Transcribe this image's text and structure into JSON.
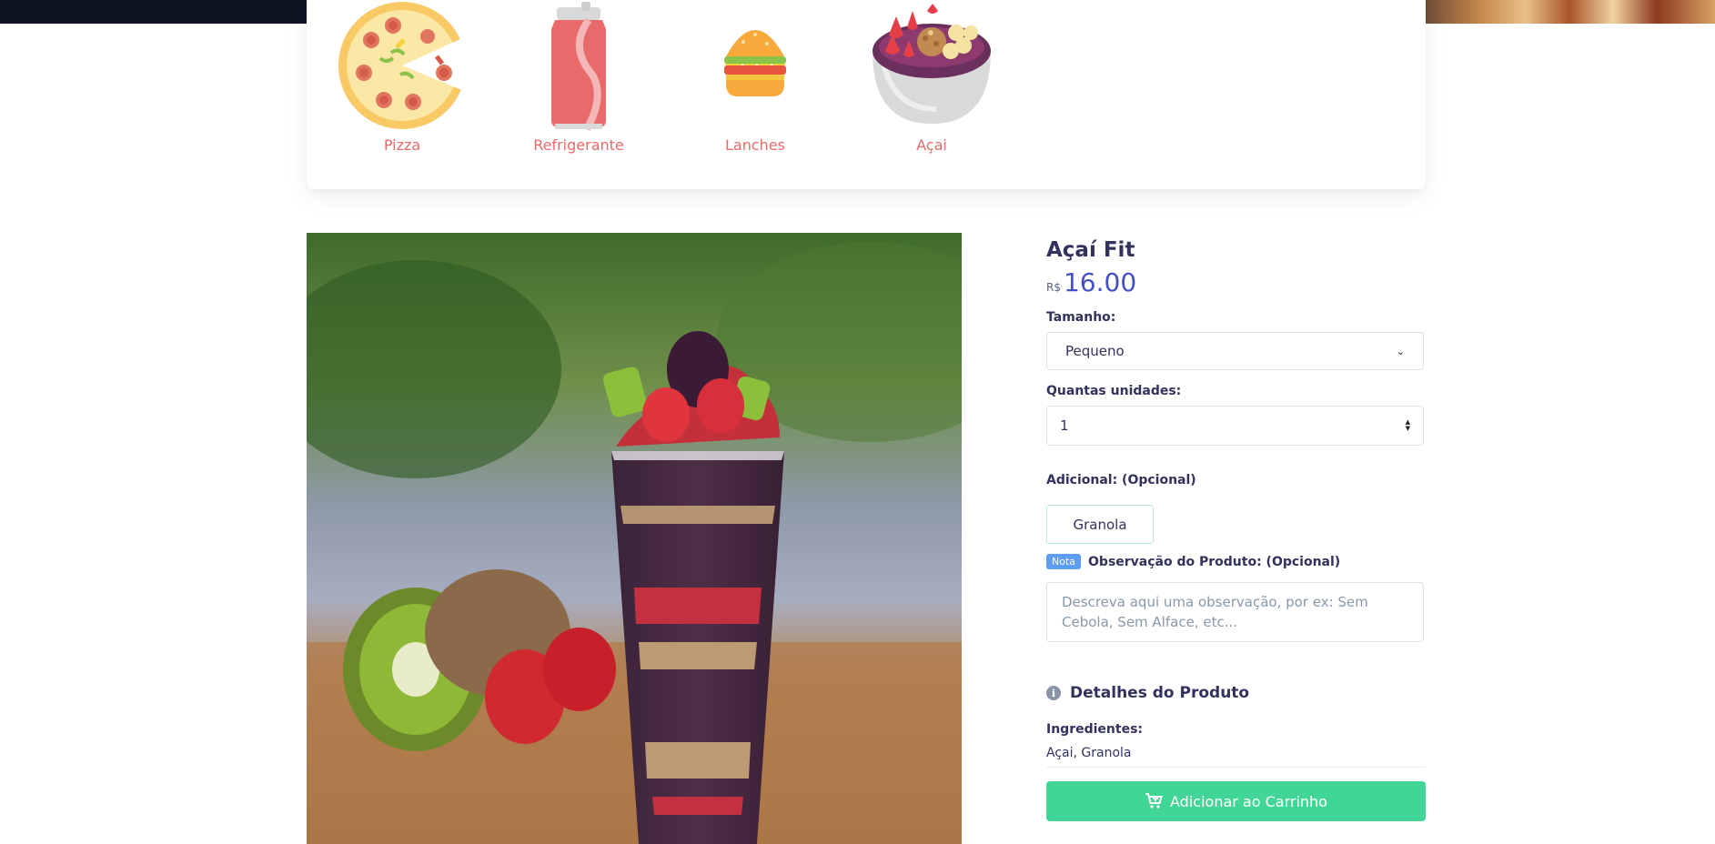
{
  "categories": [
    {
      "label": "Pizza",
      "icon": "pizza-icon"
    },
    {
      "label": "Refrigerante",
      "icon": "soda-can-icon"
    },
    {
      "label": "Lanches",
      "icon": "burger-icon"
    },
    {
      "label": "Açai",
      "icon": "acai-bowl-icon"
    }
  ],
  "product": {
    "name": "Açaí Fit",
    "currency": "R$",
    "price": "16.00",
    "image_icon": "acai-cup-photo"
  },
  "form": {
    "size_label": "Tamanho:",
    "size_value": "Pequeno",
    "qty_label": "Quantas unidades:",
    "qty_value": "1",
    "addon_label": "Adicional: (Opcional)",
    "addons": [
      "Granola"
    ],
    "note_badge": "Nota",
    "note_label": "Observação do Produto: (Opcional)",
    "note_placeholder": "Descreva aqui uma observação, por ex: Sem Cebola, Sem Alface, etc..."
  },
  "details": {
    "title": "Detalhes do Produto",
    "ingredients_label": "Ingredientes:",
    "ingredients": "Açai, Granola"
  },
  "cart": {
    "label": "Adicionar ao Carrinho",
    "icon": "cart-plus-icon"
  },
  "colors": {
    "accent_price": "#4450c6",
    "category_text": "#e86a6a",
    "cart_button": "#41d696",
    "badge": "#5e9ef2"
  }
}
